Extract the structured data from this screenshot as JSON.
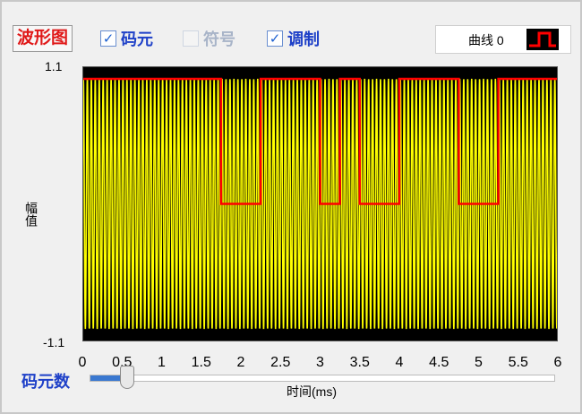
{
  "toolbar": {
    "waveform_button": "波形图",
    "checkboxes": [
      {
        "label": "码元",
        "checked": true,
        "enabled": true
      },
      {
        "label": "符号",
        "checked": false,
        "enabled": false
      },
      {
        "label": "调制",
        "checked": true,
        "enabled": true
      }
    ],
    "legend": {
      "label": "曲线 0",
      "swatch_color": "#ff0000"
    }
  },
  "slider": {
    "label": "码元数",
    "value_fraction": 0.08
  },
  "chart_data": {
    "type": "line",
    "xlabel": "时间(ms)",
    "ylabel": "幅值",
    "xlim": [
      0,
      6
    ],
    "ylim": [
      -1.1,
      1.1
    ],
    "x_ticks": [
      "0",
      "0.5",
      "1",
      "1.5",
      "2",
      "2.5",
      "3",
      "3.5",
      "4",
      "4.5",
      "5",
      "5.5",
      "6"
    ],
    "y_ticks": [
      "1.1",
      "-1.1"
    ],
    "background": "#000000",
    "series": [
      {
        "name": "调制",
        "color": "#ffff00",
        "carrier_cycles": 120,
        "amplitude": 1.0
      },
      {
        "name": "曲线 0",
        "color": "#ff0000",
        "steps": [
          {
            "x0": 0,
            "x1": 1.75,
            "y": 1.0
          },
          {
            "x0": 1.75,
            "x1": 2.25,
            "y": 0.0
          },
          {
            "x0": 2.25,
            "x1": 3.0,
            "y": 1.0
          },
          {
            "x0": 3.0,
            "x1": 3.25,
            "y": 0.0
          },
          {
            "x0": 3.25,
            "x1": 3.5,
            "y": 1.0
          },
          {
            "x0": 3.5,
            "x1": 4.0,
            "y": 0.0
          },
          {
            "x0": 4.0,
            "x1": 4.75,
            "y": 1.0
          },
          {
            "x0": 4.75,
            "x1": 5.25,
            "y": 0.0
          },
          {
            "x0": 5.25,
            "x1": 6.0,
            "y": 1.0
          }
        ]
      }
    ]
  }
}
